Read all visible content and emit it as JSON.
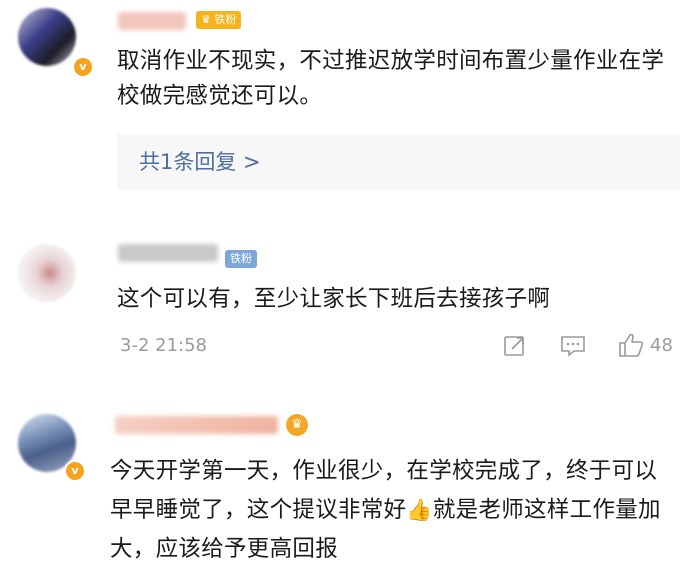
{
  "comments": [
    {
      "fan_badge": "铁粉",
      "text": "取消作业不现实，不过推迟放学时间布置少量作业在学校做完感觉还可以。",
      "reply_link": "共1条回复 >"
    },
    {
      "fan_badge": "铁粉",
      "text": "这个可以有，至少让家长下班后去接孩子啊",
      "timestamp": "3-2 21:58",
      "like_count": "48"
    },
    {
      "text_before_emoji": "今天开学第一天，作业很少，在学校完成了，终于可以早早睡觉了，这个提议非常好",
      "emoji": "👍",
      "text_after_emoji": "就是老师这样工作量加大，应该给予更高回报"
    }
  ],
  "colors": {
    "link": "#4d6f9b",
    "meta": "#9a9a9a",
    "badge_crown": "#f6b21a",
    "badge_iron": "#7ea6d8"
  }
}
